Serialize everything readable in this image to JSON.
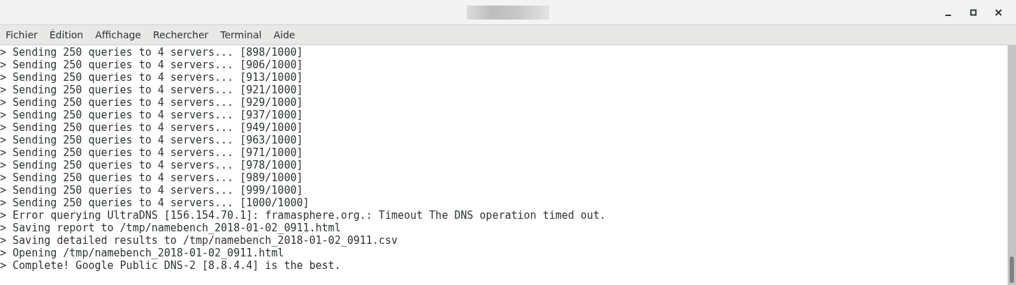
{
  "menu": [
    "Fichier",
    "Édition",
    "Affichage",
    "Rechercher",
    "Terminal",
    "Aide"
  ],
  "terminal": {
    "lines": [
      "> Sending 250 queries to 4 servers... [898/1000]",
      "> Sending 250 queries to 4 servers... [906/1000]",
      "> Sending 250 queries to 4 servers... [913/1000]",
      "> Sending 250 queries to 4 servers... [921/1000]",
      "> Sending 250 queries to 4 servers... [929/1000]",
      "> Sending 250 queries to 4 servers... [937/1000]",
      "> Sending 250 queries to 4 servers... [949/1000]",
      "> Sending 250 queries to 4 servers... [963/1000]",
      "> Sending 250 queries to 4 servers... [971/1000]",
      "> Sending 250 queries to 4 servers... [978/1000]",
      "> Sending 250 queries to 4 servers... [989/1000]",
      "> Sending 250 queries to 4 servers... [999/1000]",
      "> Sending 250 queries to 4 servers... [1000/1000]",
      "> Error querying UltraDNS [156.154.70.1]: framasphere.org.: Timeout The DNS operation timed out.",
      "> Saving report to /tmp/namebench_2018-01-02_0911.html",
      "> Saving detailed results to /tmp/namebench_2018-01-02_0911.csv",
      "> Opening /tmp/namebench_2018-01-02_0911.html",
      "> Complete! Google Public DNS-2 [8.8.4.4] is the best."
    ]
  }
}
